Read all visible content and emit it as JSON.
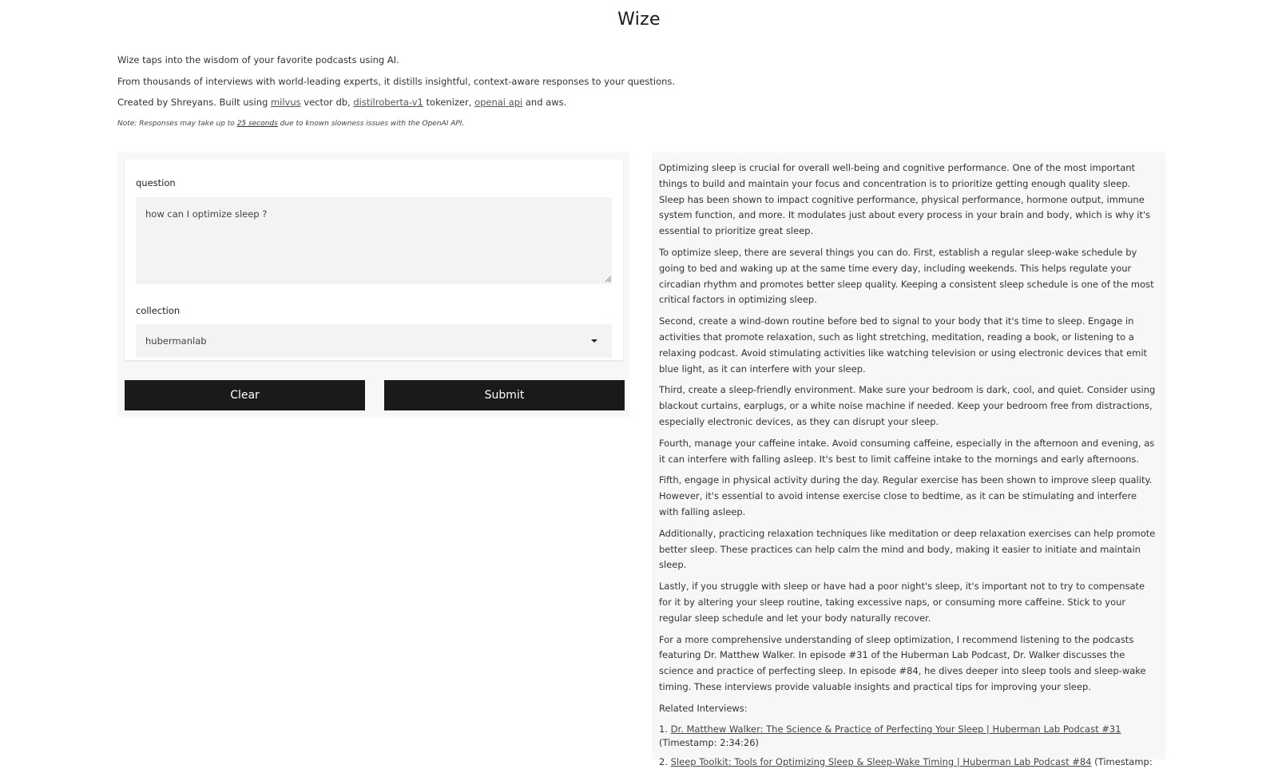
{
  "app": {
    "title": "Wize"
  },
  "intro": {
    "line1": "Wize taps into the wisdom of your favorite podcasts using AI.",
    "line2": "From thousands of interviews with world-leading experts, it distills insightful, context-aware responses to your questions.",
    "line3_prefix": "Created by Shreyans. Built using ",
    "link_milvus": "milvus",
    "line3_mid1": " vector db, ",
    "link_distilroberta": "distilroberta-v1",
    "line3_mid2": " tokenizer, ",
    "link_openai": "openai api",
    "line3_suffix": " and aws.",
    "note_prefix": "Note: Responses may take up to ",
    "note_emph": "25 seconds",
    "note_suffix": " due to known slowness issues with the OpenAI API."
  },
  "form": {
    "question_label": "question",
    "question_value": "how can I optimize sleep ?",
    "collection_label": "collection",
    "collection_value": "hubermanlab",
    "clear_label": "Clear",
    "submit_label": "Submit"
  },
  "answer": {
    "paragraphs": [
      "Optimizing sleep is crucial for overall well-being and cognitive performance. One of the most important things to build and maintain your focus and concentration is to prioritize getting enough quality sleep. Sleep has been shown to impact cognitive performance, physical performance, hormone output, immune system function, and more. It modulates just about every process in your brain and body, which is why it's essential to prioritize great sleep.",
      "To optimize sleep, there are several things you can do. First, establish a regular sleep-wake schedule by going to bed and waking up at the same time every day, including weekends. This helps regulate your circadian rhythm and promotes better sleep quality. Keeping a consistent sleep schedule is one of the most critical factors in optimizing sleep.",
      "Second, create a wind-down routine before bed to signal to your body that it's time to sleep. Engage in activities that promote relaxation, such as light stretching, meditation, reading a book, or listening to a relaxing podcast. Avoid stimulating activities like watching television or using electronic devices that emit blue light, as it can interfere with your sleep.",
      "Third, create a sleep-friendly environment. Make sure your bedroom is dark, cool, and quiet. Consider using blackout curtains, earplugs, or a white noise machine if needed. Keep your bedroom free from distractions, especially electronic devices, as they can disrupt your sleep.",
      "Fourth, manage your caffeine intake. Avoid consuming caffeine, especially in the afternoon and evening, as it can interfere with falling asleep. It's best to limit caffeine intake to the mornings and early afternoons.",
      "Fifth, engage in physical activity during the day. Regular exercise has been shown to improve sleep quality. However, it's essential to avoid intense exercise close to bedtime, as it can be stimulating and interfere with falling asleep.",
      "Additionally, practicing relaxation techniques like meditation or deep relaxation exercises can help promote better sleep. These practices can help calm the mind and body, making it easier to initiate and maintain sleep.",
      "Lastly, if you struggle with sleep or have had a poor night's sleep, it's important not to try to compensate for it by altering your sleep routine, taking excessive naps, or consuming more caffeine. Stick to your regular sleep schedule and let your body naturally recover.",
      "For a more comprehensive understanding of sleep optimization, I recommend listening to the podcasts featuring Dr. Matthew Walker. In episode #31 of the Huberman Lab Podcast, Dr. Walker discusses the science and practice of perfecting sleep. In episode #84, he dives deeper into sleep tools and sleep-wake timing. These interviews provide valuable insights and practical tips for improving your sleep."
    ],
    "related_heading": "Related Interviews:",
    "related": [
      {
        "num": "1. ",
        "title": "Dr. Matthew Walker: The Science & Practice of Perfecting Your Sleep | Huberman Lab Podcast #31",
        "timestamp": " (Timestamp: 2:34:26)"
      },
      {
        "num": "2. ",
        "title": "Sleep Toolkit: Tools for Optimizing Sleep & Sleep-Wake Timing | Huberman Lab Podcast #84",
        "timestamp": " (Timestamp:"
      }
    ]
  }
}
